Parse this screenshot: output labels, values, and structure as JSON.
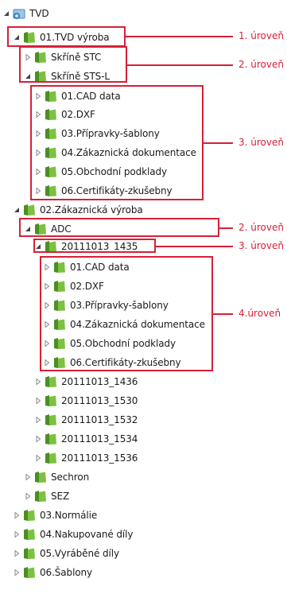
{
  "root": {
    "label": "TVD",
    "icon": "network-folder-icon"
  },
  "tree": {
    "vyroba": {
      "label": "01.TVD výroba"
    },
    "skrine_stc": {
      "label": "Skříně STC"
    },
    "skrine_stsl": {
      "label": "Skříně STS-L"
    },
    "stsl_children": [
      "01.CAD data",
      "02.DXF",
      "03.Přípravky-šablony",
      "04.Zákaznická dokumentace",
      "05.Obchodní podklady",
      "06.Certifikáty-zkušebny"
    ],
    "zak_vyroba": {
      "label": "02.Zákaznická výroba"
    },
    "adc": {
      "label": "ADC"
    },
    "run_1435": {
      "label": "20111013_1435"
    },
    "run_1435_children": [
      "01.CAD data",
      "02.DXF",
      "03.Přípravky-šablony",
      "04.Zákaznická dokumentace",
      "05.Obchodní podklady",
      "06.Certifikáty-zkušebny"
    ],
    "other_runs": [
      "20111013_1436",
      "20111013_1530",
      "20111013_1532",
      "20111013_1534",
      "20111013_1536"
    ],
    "sechron": {
      "label": "Sechron"
    },
    "sez": {
      "label": "SEZ"
    },
    "top_rest": [
      "03.Normálie",
      "04.Nakupované díly",
      "05.Vyráběné díly",
      "06.Šablony"
    ]
  },
  "annotations": {
    "level1": "1. úroveň",
    "level2a": "2. úroveň",
    "level3a": "3. úroveň",
    "level2b": "2. úroveň",
    "level3b": "3. úroveň",
    "level4": "4.úroveň"
  },
  "colors": {
    "highlight": "#d62037",
    "folder_green": "#7cc142",
    "folder_dark": "#4a8f22",
    "arrow_gray": "#8a8a8a",
    "text": "#1a1a1a"
  }
}
